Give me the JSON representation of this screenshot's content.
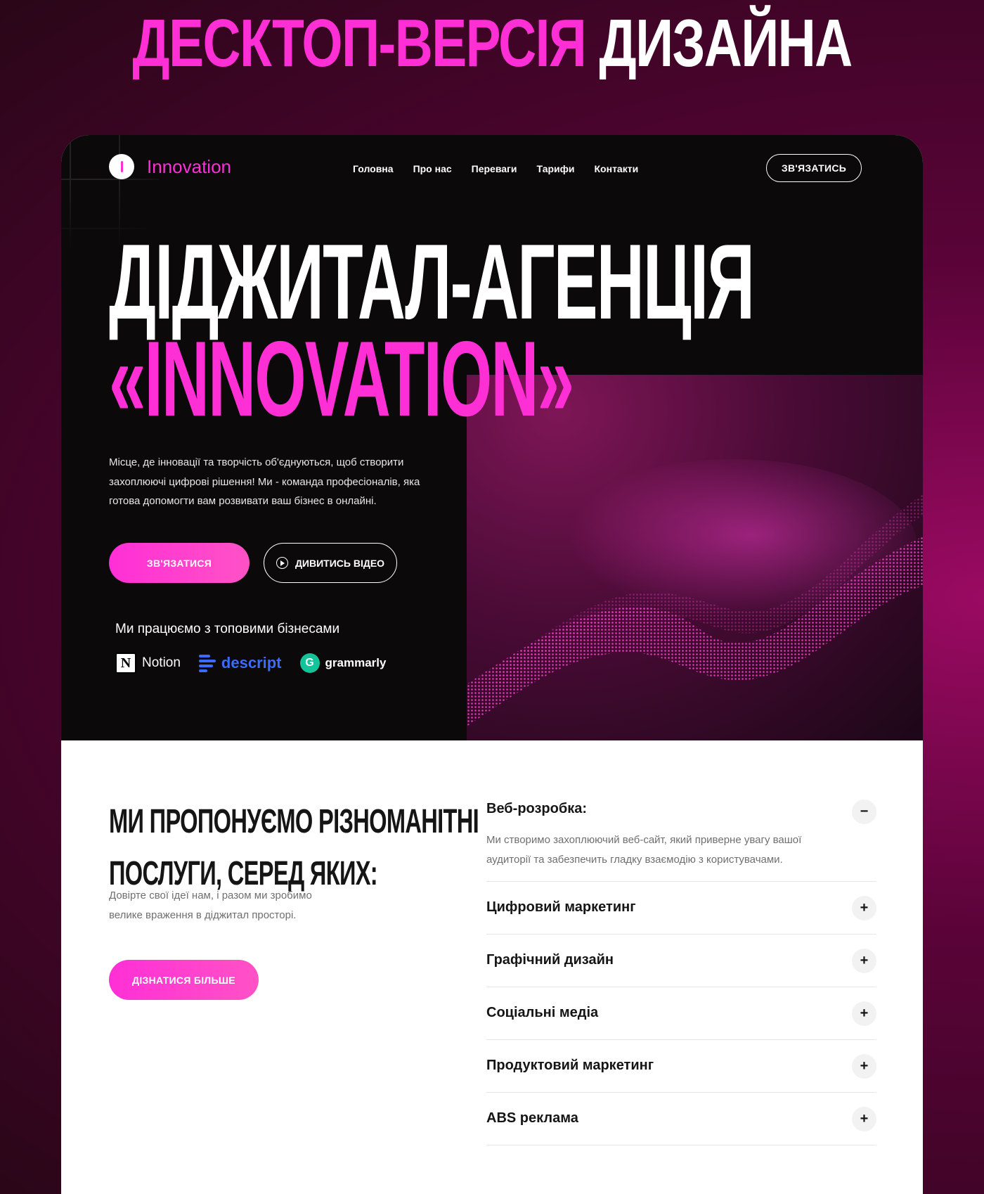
{
  "banner": {
    "title_pink": "ДЕСКТОП-ВЕРСІЯ",
    "title_white": "ДИЗАЙНА"
  },
  "header": {
    "logo_text": "Innovation",
    "nav": [
      "Головна",
      "Про нас",
      "Переваги",
      "Тарифи",
      "Контакти"
    ],
    "cta": "ЗВ'ЯЗАТИСЬ"
  },
  "hero": {
    "title_line1": "ДІДЖИТАЛ-АГЕНЦІЯ",
    "title_line2": "«INNOVATION»",
    "description": "Місце, де інновації та творчість об'єднуються, щоб створити захоплюючі цифрові рішення! Ми - команда професіоналів, яка готова допомогти вам розвивати ваш бізнес в онлайні.",
    "primary_button": "ЗВ'ЯЗАТИСЯ",
    "video_button": "ДИВИТИСЬ ВІДЕО",
    "partners_label": "Ми працюємо з топовими бізнесами",
    "partners": [
      "Notion",
      "descript",
      "grammarly"
    ]
  },
  "services": {
    "title_line1": "МИ ПРОПОНУЄМО РІЗНОМАНІТНІ",
    "title_line2": "ПОСЛУГИ, СЕРЕД ЯКИХ:",
    "description": "Довірте свої ідеї нам, і разом ми зробимо велике враження в діджитал просторі.",
    "button": "ДІЗНАТИСЯ БІЛЬШЕ",
    "items": [
      {
        "title": "Веб-розробка:",
        "body": "Ми створимо захоплюючий веб-сайт, який приверне увагу вашої аудиторії та забезпечить гладку взаємодію з користувачами.",
        "toggle": "−"
      },
      {
        "title": "Цифровий маркетинг",
        "toggle": "+"
      },
      {
        "title": "Графічний дизайн",
        "toggle": "+"
      },
      {
        "title": "Соціальні медіа",
        "toggle": "+"
      },
      {
        "title": "Продуктовий маркетинг",
        "toggle": "+"
      },
      {
        "title": "ABS реклама",
        "toggle": "+"
      }
    ]
  },
  "colors": {
    "accent": "#ff2fd6",
    "dark": "#0b0909",
    "background": "#5a0338"
  }
}
